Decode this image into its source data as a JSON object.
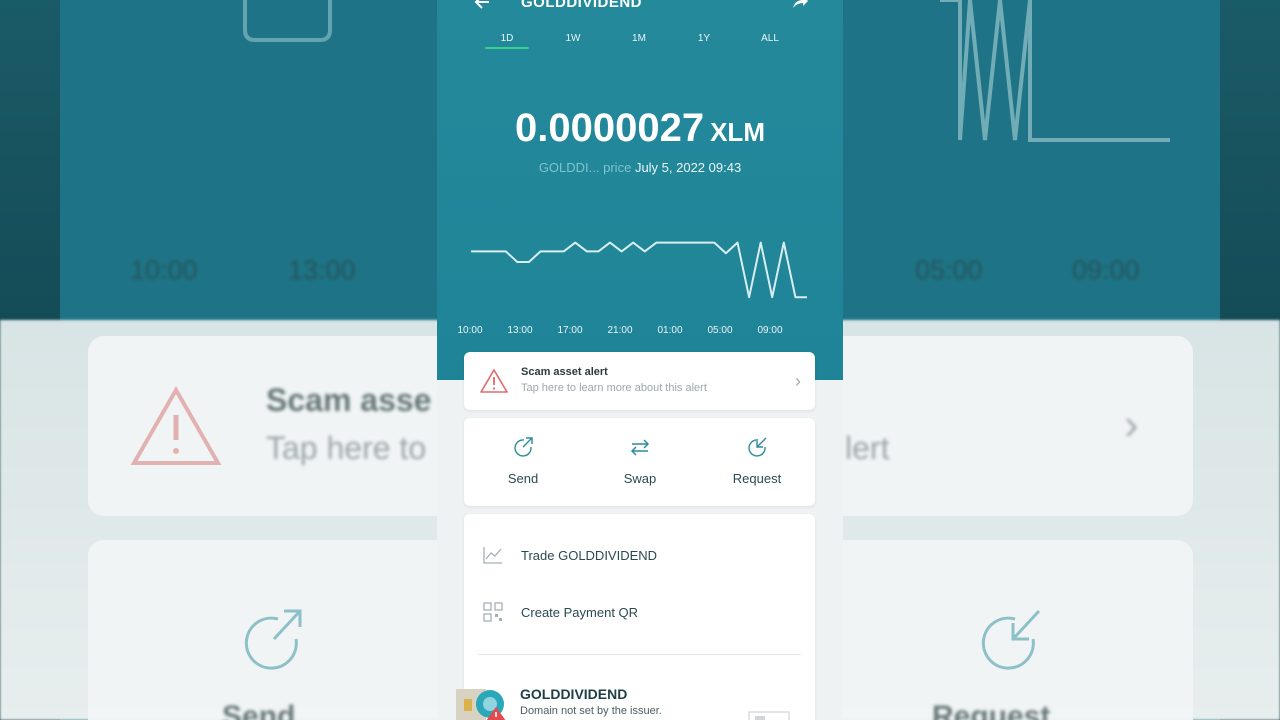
{
  "header": {
    "title": "GOLDDIVIDEND"
  },
  "tabs": [
    {
      "label": "1D",
      "active": true
    },
    {
      "label": "1W",
      "active": false
    },
    {
      "label": "1M",
      "active": false
    },
    {
      "label": "1Y",
      "active": false
    },
    {
      "label": "ALL",
      "active": false
    }
  ],
  "price": {
    "value": "0.0000027",
    "currency": "XLM",
    "asset_short": "GOLDDI...",
    "price_word": "price",
    "date": "July 5, 2022 09:43"
  },
  "chart_data": {
    "type": "line",
    "x_ticks": [
      "10:00",
      "13:00",
      "17:00",
      "21:00",
      "01:00",
      "05:00",
      "09:00"
    ],
    "series": [
      {
        "values": [
          0.62,
          0.62,
          0.62,
          0.62,
          0.5,
          0.5,
          0.62,
          0.62,
          0.62,
          0.72,
          0.62,
          0.62,
          0.72,
          0.62,
          0.72,
          0.62,
          0.72,
          0.72,
          0.72,
          0.72,
          0.72,
          0.72,
          0.6,
          0.72,
          0.1,
          0.72,
          0.1,
          0.72,
          0.1,
          0.1
        ]
      }
    ],
    "color": "#d8eef2"
  },
  "alert": {
    "title": "Scam asset alert",
    "subtitle": "Tap here to learn more about this alert"
  },
  "actions": [
    {
      "label": "Send",
      "icon": "send-icon"
    },
    {
      "label": "Swap",
      "icon": "swap-icon"
    },
    {
      "label": "Request",
      "icon": "request-icon"
    }
  ],
  "menu": [
    {
      "label": "Trade GOLDDIVIDEND",
      "icon": "chart-icon"
    },
    {
      "label": "Create Payment QR",
      "icon": "qr-icon"
    }
  ],
  "asset": {
    "name": "GOLDDIVIDEND",
    "domain_note": "Domain not set by the issuer."
  },
  "background": {
    "times": [
      "10:00",
      "13:00",
      "05:00",
      "09:00"
    ],
    "alert_title": "Scam asse",
    "alert_sub": "Tap here to",
    "alert_sub_right": "lert",
    "send": "Send",
    "request": "Request"
  },
  "colors": {
    "header_bg": "#1f8497",
    "accent": "#39d08a",
    "alert_red": "#e26a6a",
    "icon_teal": "#2a8c9c"
  }
}
